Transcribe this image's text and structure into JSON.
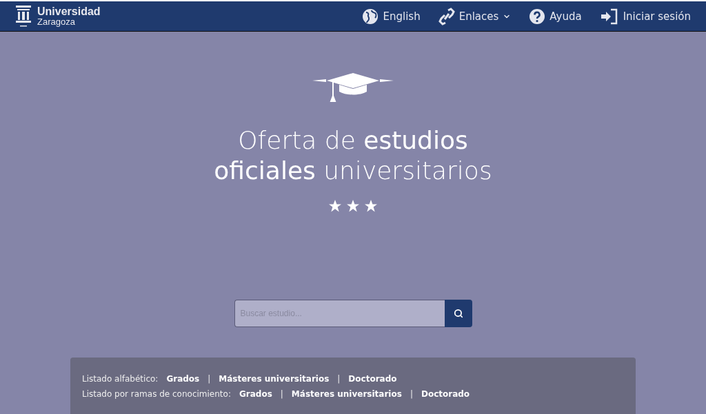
{
  "header": {
    "logo": {
      "name": "Universidad",
      "subtitle": "Zaragoza"
    },
    "nav": [
      {
        "kind": "globe",
        "label": "English"
      },
      {
        "kind": "links",
        "label": "Enlaces",
        "dropdown": true
      },
      {
        "kind": "help",
        "label": "Ayuda"
      },
      {
        "kind": "login",
        "label": "Iniciar sesión"
      }
    ]
  },
  "hero": {
    "title_lines": [
      "Oferta de **estudios**",
      "**oficiales** universitarios"
    ]
  },
  "search": {
    "placeholder": "Buscar estudio..."
  },
  "listings": [
    {
      "label": "Listado alfabético:",
      "links": [
        "Grados",
        "Másteres universitarios",
        "Doctorado"
      ],
      "separator": "|"
    },
    {
      "label": "Listado por ramas de conocimiento:",
      "links": [
        "Grados",
        "Másteres universitarios",
        "Doctorado"
      ],
      "separator": "|"
    }
  ]
}
